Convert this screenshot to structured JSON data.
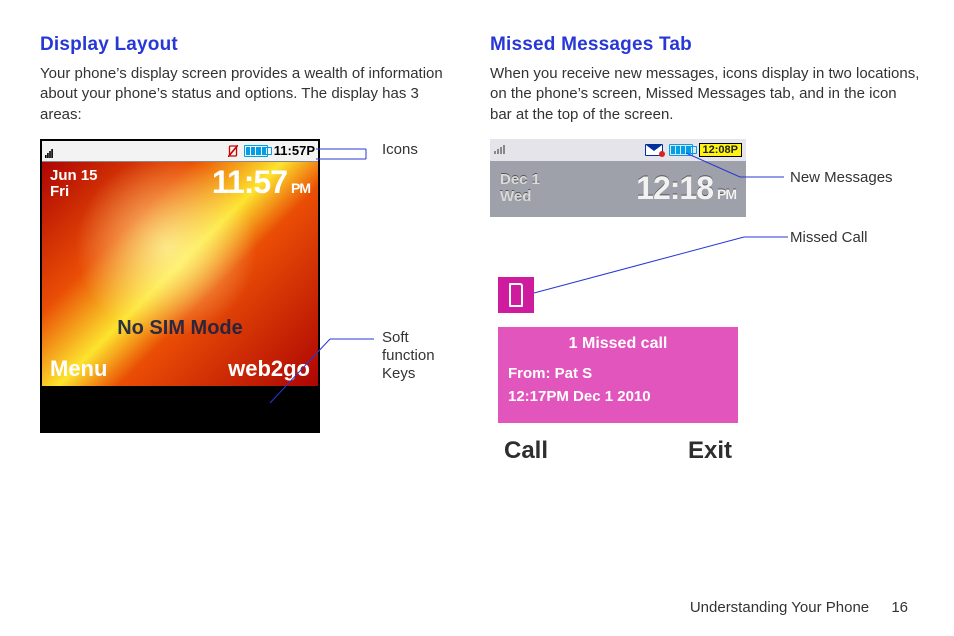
{
  "left": {
    "heading": "Display Layout",
    "desc": "Your phone’s display screen provides a wealth of information about your phone’s status and options. The display has 3 areas:",
    "status_time": "11:57P",
    "date_line1": "Jun 15",
    "date_line2": "Fri",
    "big_time": "11:57",
    "big_ampm": "PM",
    "mid_msg": "No SIM Mode",
    "soft_left": "Menu",
    "soft_right": "web2go",
    "callout_icons": "Icons",
    "callout_soft_line1": "Soft function",
    "callout_soft_line2": "Keys"
  },
  "right": {
    "heading": "Missed Messages Tab",
    "desc": "When you receive new messages, icons display in two locations, on the phone’s screen, Missed Messages tab, and in the icon bar at the top of the screen.",
    "clock_chip": "12:08P",
    "date_line1": "Dec 1",
    "date_line2": "Wed",
    "big_time": "12:18",
    "big_ampm": "PM",
    "missed_title": "1 Missed call",
    "missed_from": "From: Pat S",
    "missed_time": "12:17PM Dec 1 2010",
    "soft_left": "Call",
    "soft_right": "Exit",
    "callout_newmsg": "New Messages",
    "callout_missed": "Missed Call"
  },
  "footer": {
    "text": "Understanding Your Phone",
    "page": "16"
  }
}
